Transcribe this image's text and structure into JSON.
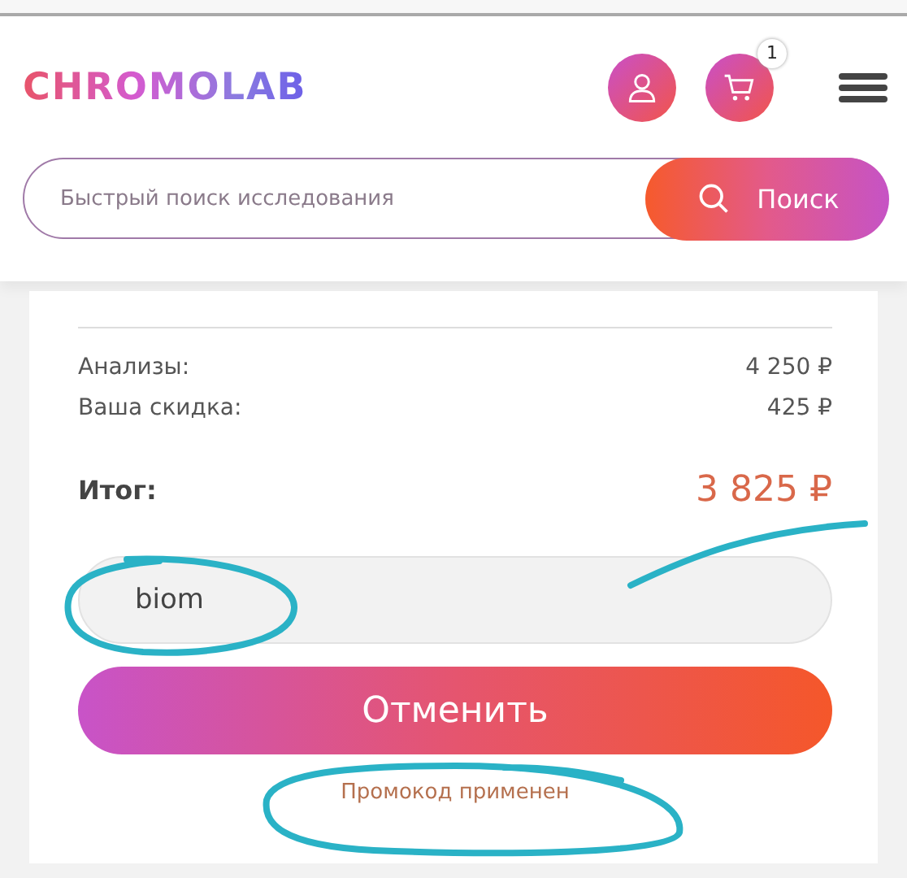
{
  "header": {
    "logo": "CHROMOLAB",
    "cart_count": "1"
  },
  "search": {
    "placeholder": "Быстрый поиск исследования",
    "button": "Поиск"
  },
  "summary": {
    "rows": [
      {
        "label": "Анализы:",
        "value": "4 250 ₽"
      },
      {
        "label": "Ваша скидка:",
        "value": "425 ₽"
      }
    ],
    "total_label": "Итог:",
    "total_value": "3 825 ₽"
  },
  "promo": {
    "value": "biom",
    "button": "Отменить",
    "status": "Промокод применен"
  },
  "annotations": [
    {
      "kind": "stroke"
    },
    {
      "kind": "ellipse-field"
    },
    {
      "kind": "ellipse-status"
    }
  ]
}
